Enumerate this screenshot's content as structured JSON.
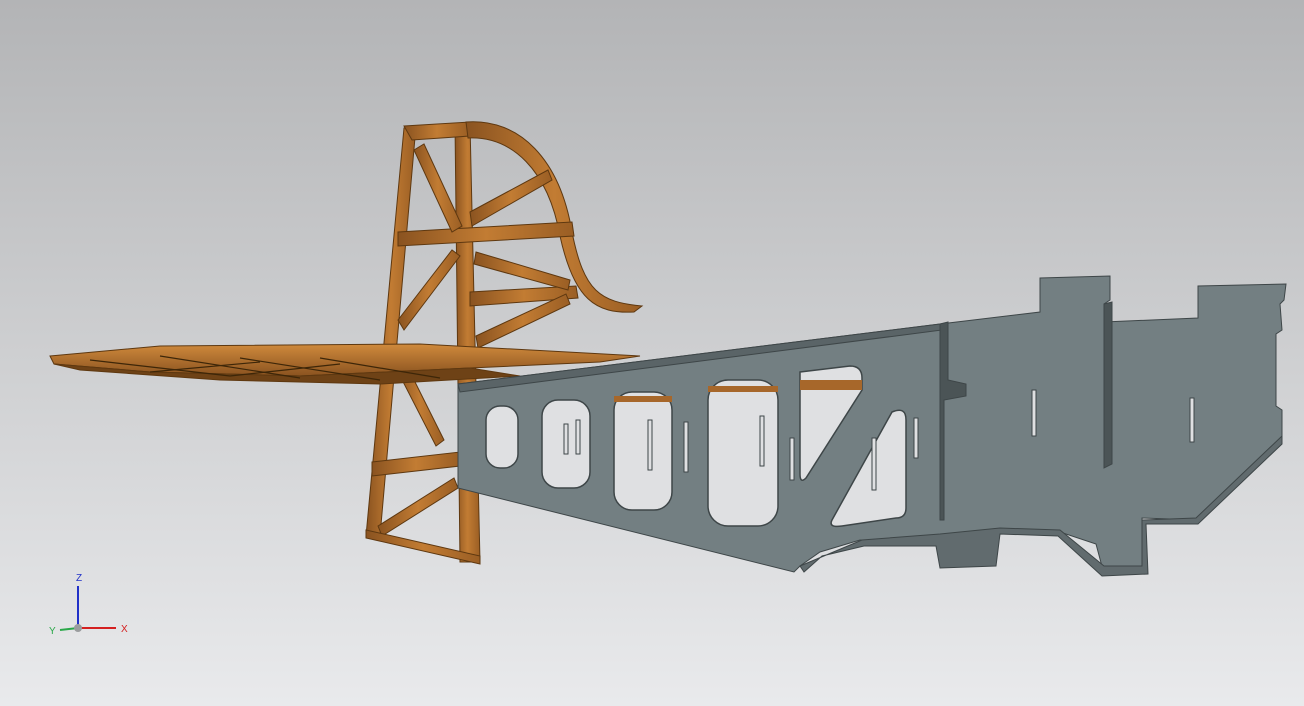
{
  "viewport": {
    "background_top": "#b3b4b6",
    "background_bottom": "#e9eaec"
  },
  "model": {
    "tail_color": "#b8732c",
    "tail_dark": "#7a4a18",
    "fuselage_color": "#737f82",
    "fuselage_dark": "#5a6467"
  },
  "triad": {
    "x_label": "X",
    "y_label": "Y",
    "z_label": "Z",
    "x_color": "#d42020",
    "y_color": "#2aa84a",
    "z_color": "#2030c8"
  }
}
